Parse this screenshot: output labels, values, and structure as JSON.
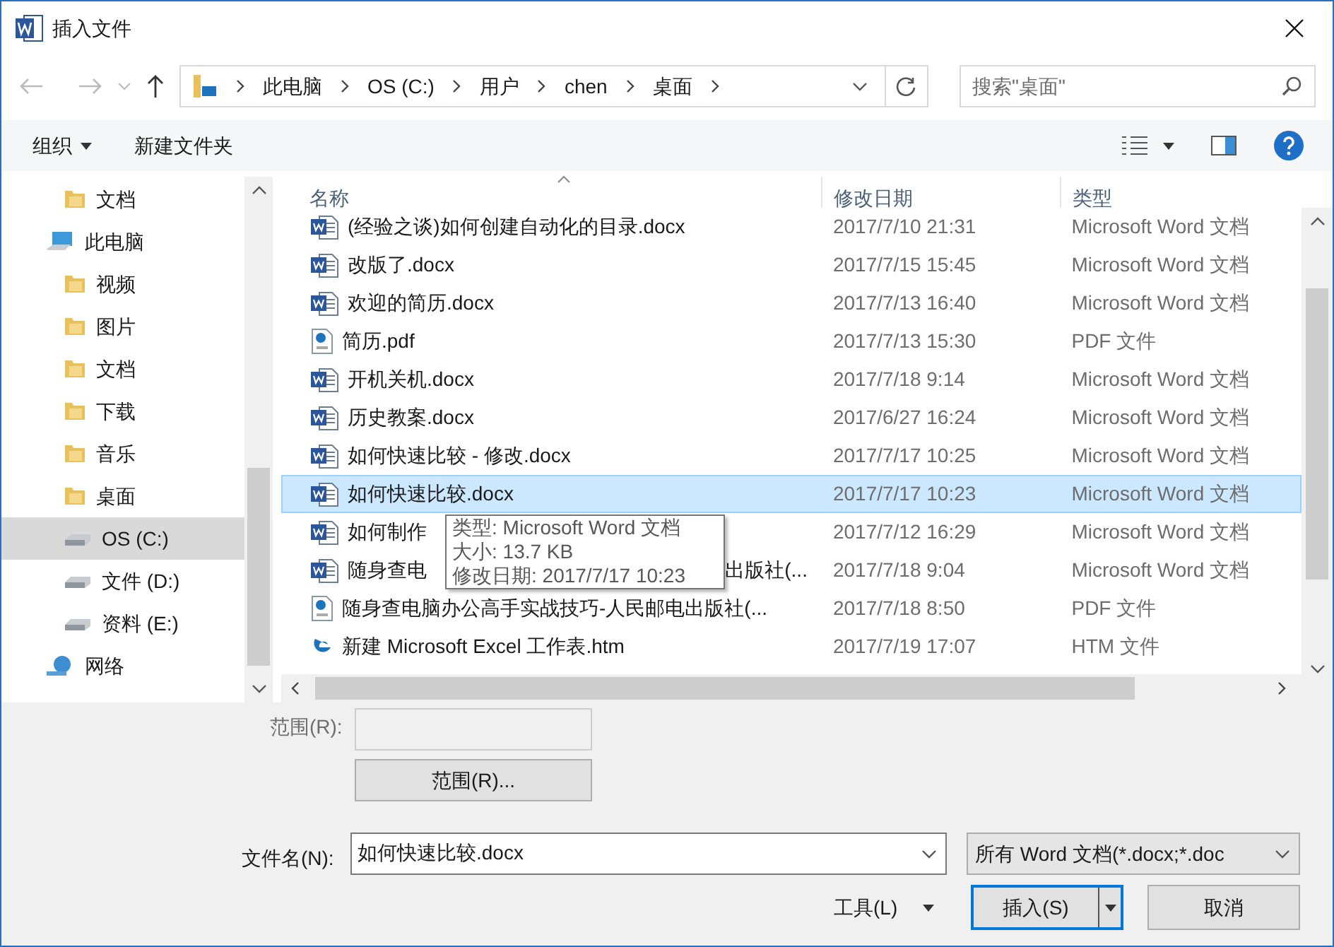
{
  "window": {
    "title": "插入文件"
  },
  "address": {
    "crumbs": [
      "此电脑",
      "OS (C:)",
      "用户",
      "chen",
      "桌面"
    ],
    "search_placeholder": "搜索\"桌面\""
  },
  "toolbar": {
    "organize": "组织",
    "new_folder": "新建文件夹"
  },
  "nav": [
    {
      "label": "文档",
      "kind": "folder",
      "selected": false
    },
    {
      "label": "此电脑",
      "kind": "pc",
      "selected": false,
      "children": [
        {
          "label": "视频",
          "kind": "folder",
          "selected": false
        },
        {
          "label": "图片",
          "kind": "folder",
          "selected": false
        },
        {
          "label": "文档",
          "kind": "folder",
          "selected": false
        },
        {
          "label": "下载",
          "kind": "folder",
          "selected": false
        },
        {
          "label": "音乐",
          "kind": "folder",
          "selected": false
        },
        {
          "label": "桌面",
          "kind": "folder",
          "selected": false
        },
        {
          "label": "OS (C:)",
          "kind": "drive",
          "selected": true
        },
        {
          "label": "文件 (D:)",
          "kind": "drive",
          "selected": false
        },
        {
          "label": "资料 (E:)",
          "kind": "drive",
          "selected": false
        }
      ]
    },
    {
      "label": "网络",
      "kind": "network",
      "selected": false
    }
  ],
  "files": {
    "columns": [
      "名称",
      "修改日期",
      "类型"
    ],
    "rows": [
      {
        "kind": "word",
        "name": "(经验之谈)如何创建自动化的目录.docx",
        "date": "2017/7/10 21:31",
        "type": "Microsoft Word 文档",
        "selected": false
      },
      {
        "kind": "word",
        "name": "改版了.docx",
        "date": "2017/7/15 15:45",
        "type": "Microsoft Word 文档",
        "selected": false
      },
      {
        "kind": "word",
        "name": "欢迎的简历.docx",
        "date": "2017/7/13 16:40",
        "type": "Microsoft Word 文档",
        "selected": false
      },
      {
        "kind": "pdf",
        "name": "简历.pdf",
        "date": "2017/7/13 15:30",
        "type": "PDF 文件",
        "selected": false
      },
      {
        "kind": "word",
        "name": "开机关机.docx",
        "date": "2017/7/18 9:14",
        "type": "Microsoft Word 文档",
        "selected": false
      },
      {
        "kind": "word",
        "name": "历史教案.docx",
        "date": "2017/6/27 16:24",
        "type": "Microsoft Word 文档",
        "selected": false
      },
      {
        "kind": "word",
        "name": "如何快速比较 - 修改.docx",
        "date": "2017/7/17 10:25",
        "type": "Microsoft Word 文档",
        "selected": false
      },
      {
        "kind": "word",
        "name": "如何快速比较.docx",
        "date": "2017/7/17 10:23",
        "type": "Microsoft Word 文档",
        "selected": true
      },
      {
        "kind": "word",
        "name": "如何制作",
        "date": "2017/7/12 16:29",
        "type": "Microsoft Word 文档",
        "selected": false
      },
      {
        "kind": "word",
        "name": "随身查电",
        "name_end": "出版社(...",
        "date": "2017/7/18 9:04",
        "type": "Microsoft Word 文档",
        "selected": false
      },
      {
        "kind": "pdf",
        "name": "随身查电脑办公高手实战技巧-人民邮电出版社(...",
        "date": "2017/7/18 8:50",
        "type": "PDF 文件",
        "selected": false
      },
      {
        "kind": "htm",
        "name": "新建 Microsoft Excel 工作表.htm",
        "date": "2017/7/19 17:07",
        "type": "HTM 文件",
        "selected": false
      }
    ]
  },
  "tooltip": [
    "类型: Microsoft Word 文档",
    "大小: 13.7 KB",
    "修改日期: 2017/7/17 10:23"
  ],
  "bottom": {
    "range_label": "范围(R):",
    "range_button": "范围(R)...",
    "filename_label": "文件名(N):",
    "filename": "如何快速比较.docx",
    "filter": "所有 Word 文档(*.docx;*.doc",
    "tools": "工具(L)",
    "insert": "插入(S)",
    "cancel": "取消"
  }
}
